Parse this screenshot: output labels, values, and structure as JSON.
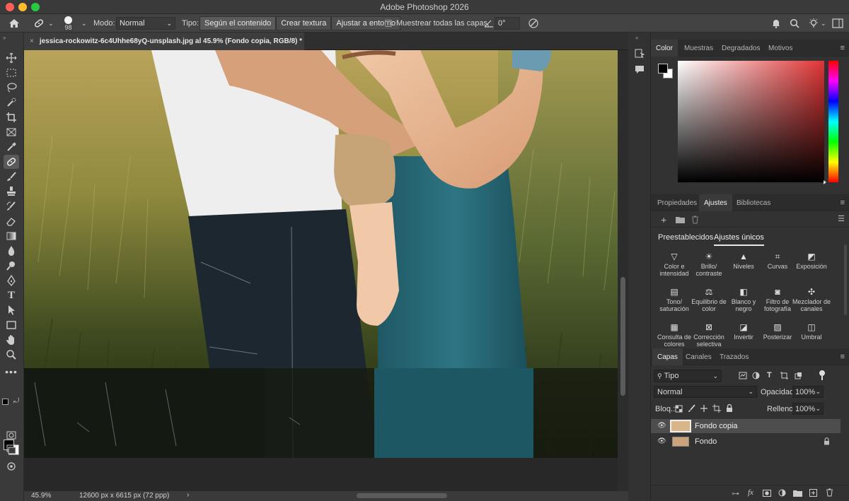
{
  "window": {
    "title": "Adobe Photoshop 2026"
  },
  "options_bar": {
    "brush_size": "98",
    "mode_label": "Modo:",
    "mode_value": "Normal",
    "type_label": "Tipo:",
    "type_buttons": [
      "Según el contenido",
      "Crear textura",
      "Ajustar a entorno"
    ],
    "sample_all_label": "Muestrear todas las capas",
    "angle_value": "0°"
  },
  "document": {
    "tab_title": "jessica-rockowitz-6c4Uhhe68yQ-unsplash.jpg al 45.9% (Fondo copia, RGB/8) *"
  },
  "status_bar": {
    "zoom": "45.9%",
    "doc_size": "12600 px x 6615 px (72 ppp)",
    "arrow": "›"
  },
  "color_panel": {
    "tabs": [
      "Color",
      "Muestras",
      "Degradados",
      "Motivos"
    ],
    "active_tab": "Color",
    "hue_color": "#e03434"
  },
  "adjust_panel": {
    "tabs": [
      "Propiedades",
      "Ajustes",
      "Bibliotecas"
    ],
    "active_tab": "Ajustes",
    "subtabs": [
      "Preestablecidos",
      "Ajustes únicos"
    ],
    "items": [
      {
        "label": "Color e intensidad",
        "icon": "triangle-icon"
      },
      {
        "label": "Brillo/ contraste",
        "icon": "sun-icon"
      },
      {
        "label": "Niveles",
        "icon": "levels-icon"
      },
      {
        "label": "Curvas",
        "icon": "curves-icon"
      },
      {
        "label": "Exposición",
        "icon": "exposure-icon"
      },
      {
        "label": "Tono/ saturación",
        "icon": "hue-icon"
      },
      {
        "label": "Equilibrio de color",
        "icon": "balance-icon"
      },
      {
        "label": "Blanco y negro",
        "icon": "bw-icon"
      },
      {
        "label": "Filtro de fotografía",
        "icon": "camera-icon"
      },
      {
        "label": "Mezclador de canales",
        "icon": "mixer-icon"
      },
      {
        "label": "Consulta de colores",
        "icon": "grid-icon"
      },
      {
        "label": "Corrección selectiva",
        "icon": "selective-icon"
      },
      {
        "label": "Invertir",
        "icon": "invert-icon"
      },
      {
        "label": "Posterizar",
        "icon": "posterize-icon"
      },
      {
        "label": "Umbral",
        "icon": "threshold-icon"
      }
    ]
  },
  "layers_panel": {
    "tabs": [
      "Capas",
      "Canales",
      "Trazados"
    ],
    "active_tab": "Capas",
    "filter_label": "Tipo",
    "blend_mode": "Normal",
    "opacity_label": "Opacidad:",
    "opacity_value": "100%",
    "lock_label": "Bloq.:",
    "fill_label": "Relleno:",
    "fill_value": "100%",
    "layers": [
      {
        "name": "Fondo copia",
        "selected": true
      },
      {
        "name": "Fondo",
        "selected": false
      }
    ]
  }
}
